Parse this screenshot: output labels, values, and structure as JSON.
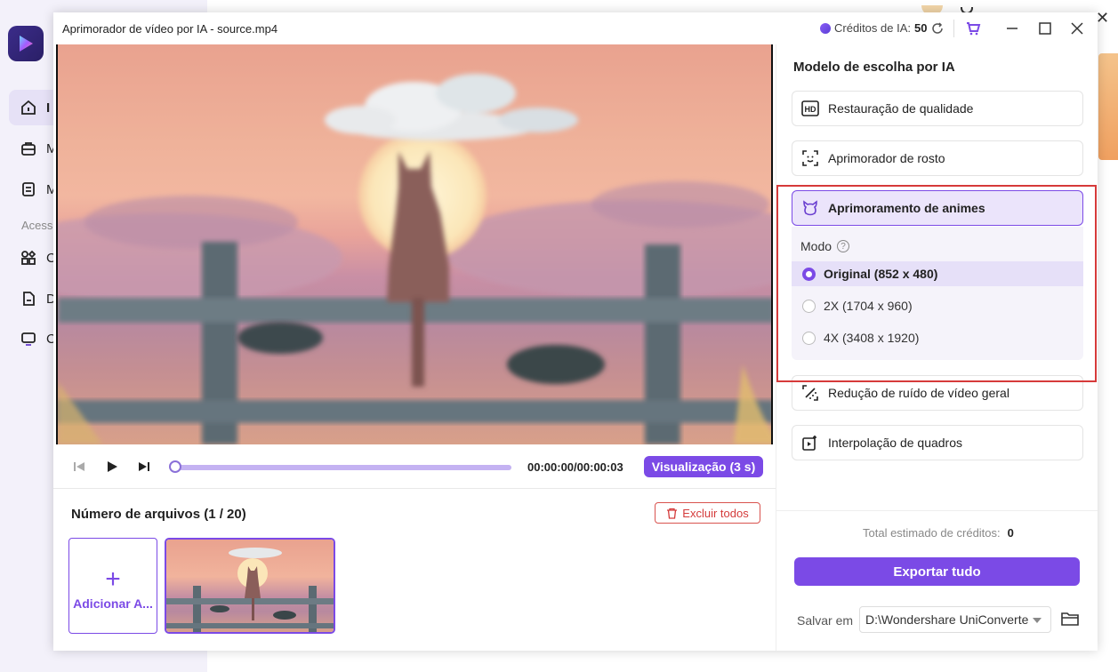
{
  "background_app": {
    "nav_items": [
      {
        "label": "I"
      },
      {
        "label": "M"
      },
      {
        "label": "M"
      },
      {
        "label": "C"
      },
      {
        "label": "D"
      },
      {
        "label": "C"
      }
    ],
    "section_label": "Acess"
  },
  "dialog": {
    "title": "Aprimorador de vídeo por IA - source.mp4",
    "credits_label": "Créditos de IA:",
    "credits_value": "50"
  },
  "player": {
    "timecode": "00:00:00/00:00:03",
    "preview_label": "Visualização (3 s)",
    "progress": 0.0
  },
  "files": {
    "count_label": "Número de arquivos (1 / 20)",
    "delete_all_label": "Excluir todos",
    "add_label": "Adicionar A..."
  },
  "panel": {
    "title": "Modelo de escolha por IA",
    "models": [
      {
        "label": "Restauração de qualidade",
        "icon": "hd-icon"
      },
      {
        "label": "Aprimorador de rosto",
        "icon": "face-scan-icon"
      },
      {
        "label": "Aprimoramento de animes",
        "icon": "anime-icon",
        "selected": true
      },
      {
        "label": "Redução de ruído de vídeo geral",
        "icon": "denoise-icon"
      },
      {
        "label": "Interpolação de quadros",
        "icon": "frame-interpolation-icon"
      }
    ],
    "mode_label": "Modo",
    "modes": [
      {
        "label": "Original (852 x 480)",
        "selected": true
      },
      {
        "label": "2X (1704 x 960)",
        "selected": false
      },
      {
        "label": "4X (3408 x 1920)",
        "selected": false
      }
    ],
    "total_credits_label": "Total estimado de créditos:",
    "total_credits_value": "0",
    "export_label": "Exportar tudo",
    "save_label": "Salvar em",
    "save_path": "D:\\Wondershare UniConverte"
  },
  "colors": {
    "accent": "#7b4ae6",
    "highlight": "#d63a3a"
  }
}
